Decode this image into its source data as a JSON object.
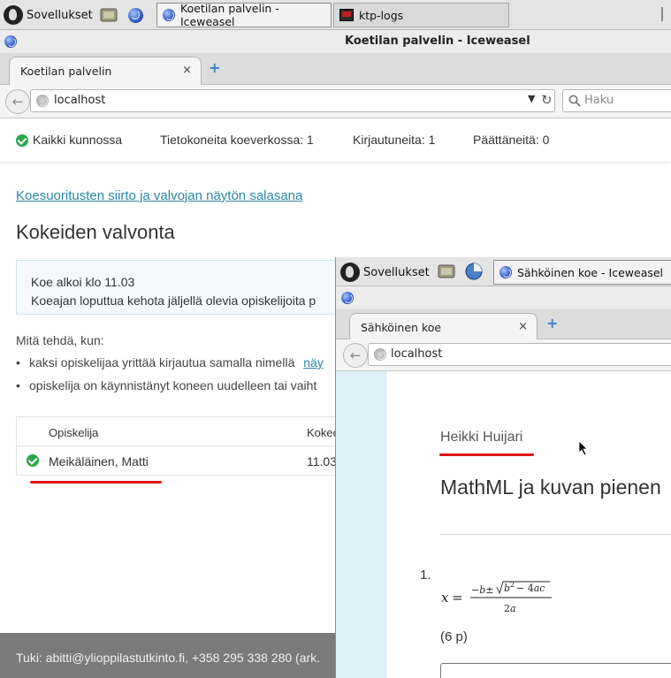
{
  "taskbar": {
    "apps_label": "Sovellukset",
    "windows": [
      {
        "title": "Koetilan palvelin - Iceweasel",
        "active": true
      },
      {
        "title": "ktp-logs",
        "active": false
      }
    ]
  },
  "main_window": {
    "title": "Koetilan palvelin - Iceweasel",
    "tab_label": "Koetilan palvelin",
    "tab_close": "×",
    "new_tab": "+",
    "url": "localhost",
    "search_placeholder": "Haku",
    "reload": "↻"
  },
  "status": {
    "ok_text": "Kaikki kunnossa",
    "computers": "Tietokoneita koeverkossa: 1",
    "logged_in": "Kirjautuneita: 1",
    "finished": "Päättäneitä: 0",
    "ok_color": "#2ea44f"
  },
  "page": {
    "top_link": "Koesuoritusten siirto ja valvojan näytön salasana",
    "heading": "Kokeiden valvonta",
    "info_line1": "Koe alkoi klo 11.03",
    "info_line2": "Koeajan loputtua kehota jäljellä olevia opiskelijoita p",
    "what_to_do": "Mitä tehdä, kun:",
    "bullets": [
      {
        "text": "kaksi opiskelijaa yrittää kirjautua samalla nimellä",
        "link": "näy"
      },
      {
        "text": "opiskelija on käynnistänyt koneen uudelleen tai vaiht",
        "link": ""
      }
    ],
    "table": {
      "headers": [
        "Opiskelija",
        "Kokeo"
      ],
      "rows": [
        {
          "name": "Meikäläinen, Matti",
          "time": "11.03"
        }
      ]
    },
    "footer": "Tuki: abitti@ylioppilastutkinto.fi, +358 295 338 280 (ark."
  },
  "overlay_window": {
    "apps_label": "Sovellukset",
    "window_title": "Sähköinen koe - Iceweasel",
    "tab_label": "Sähköinen koe",
    "tab_close": "×",
    "new_tab": "+",
    "url": "localhost",
    "student_name": "Heikki Huijari",
    "exam_title": "MathML ja kuvan pienen",
    "question_number": "1.",
    "points": "(6 p)"
  },
  "annotation_color": "#e01515"
}
